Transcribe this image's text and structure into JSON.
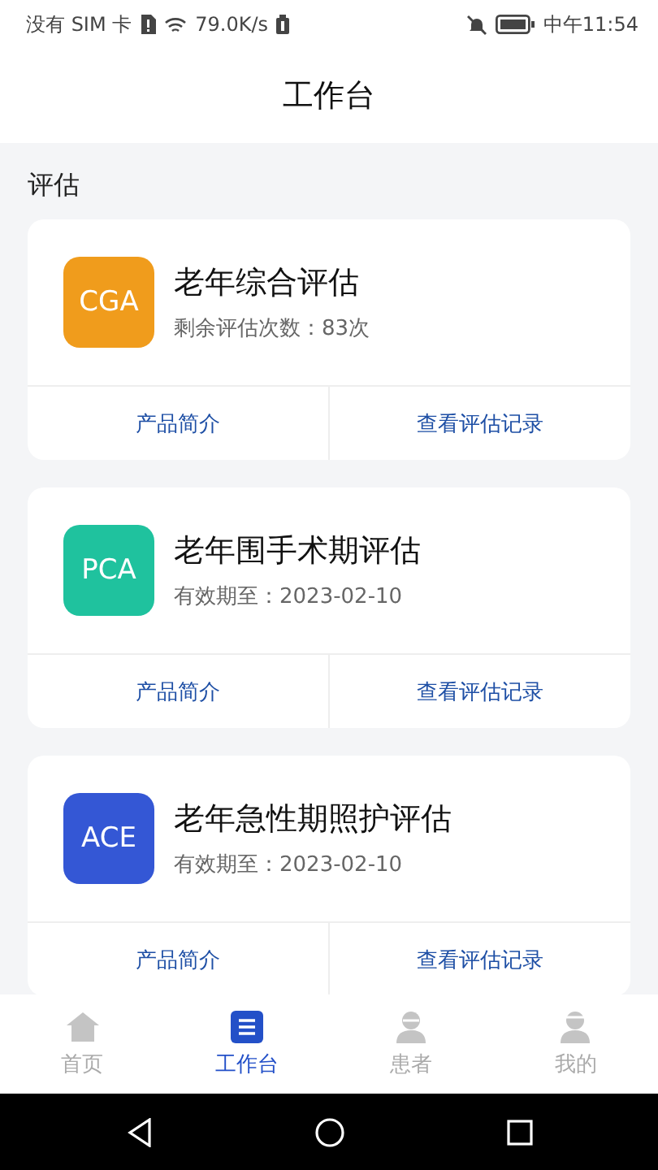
{
  "status_bar": {
    "carrier": "没有 SIM 卡",
    "speed": "79.0K/s",
    "time": "中午11:54"
  },
  "header": {
    "title": "工作台"
  },
  "section": {
    "title": "评估"
  },
  "cards": [
    {
      "logo": "CGA",
      "color": "#f09c1c",
      "title": "老年综合评估",
      "subtitle": "剩余评估次数：83次",
      "actions": [
        "产品简介",
        "查看评估记录"
      ]
    },
    {
      "logo": "PCA",
      "color": "#1fc29e",
      "title": "老年围手术期评估",
      "subtitle": "有效期至：2023-02-10",
      "actions": [
        "产品简介",
        "查看评估记录"
      ]
    },
    {
      "logo": "ACE",
      "color": "#3457d5",
      "title": "老年急性期照护评估",
      "subtitle": "有效期至：2023-02-10",
      "actions": [
        "产品简介",
        "查看评估记录"
      ]
    }
  ],
  "tab_bar": [
    {
      "label": "首页",
      "kind": "home",
      "selected": false
    },
    {
      "label": "工作台",
      "kind": "workbench",
      "selected": true
    },
    {
      "label": "患者",
      "kind": "patient",
      "selected": false
    },
    {
      "label": "我的",
      "kind": "me",
      "selected": false
    }
  ]
}
